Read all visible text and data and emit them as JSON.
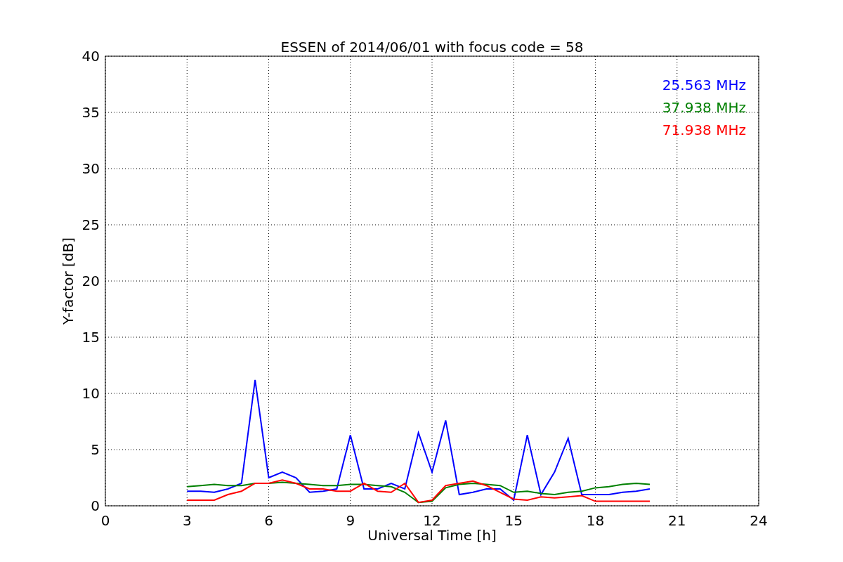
{
  "chart_data": {
    "type": "line",
    "title": "ESSEN of 2014/06/01 with focus code = 58",
    "xlabel": "Universal Time [h]",
    "ylabel": "Y-factor [dB]",
    "x": [
      3,
      3.5,
      4,
      4.5,
      5,
      5.5,
      6,
      6.5,
      7,
      7.5,
      8,
      8.5,
      9,
      9.5,
      10,
      10.5,
      11,
      11.5,
      12,
      12.5,
      13,
      13.5,
      14,
      14.5,
      15,
      15.5,
      16,
      16.5,
      17,
      17.5,
      18,
      18.5,
      19,
      19.5,
      20
    ],
    "series": [
      {
        "name": "25.563 MHz",
        "color": "#0000ff",
        "values": [
          1.3,
          1.3,
          1.2,
          1.5,
          2.0,
          11.2,
          2.5,
          3.0,
          2.5,
          1.2,
          1.3,
          1.5,
          6.3,
          1.5,
          1.5,
          2.0,
          1.5,
          6.5,
          3.0,
          7.6,
          1.0,
          1.2,
          1.5,
          1.5,
          0.5,
          6.3,
          1.0,
          3.0,
          6.0,
          1.0,
          1.0,
          1.0,
          1.2,
          1.3,
          1.5
        ]
      },
      {
        "name": "37.938 MHz",
        "color": "#008000",
        "values": [
          1.7,
          1.8,
          1.9,
          1.8,
          1.8,
          2.0,
          2.0,
          2.1,
          2.0,
          1.9,
          1.8,
          1.8,
          1.9,
          1.9,
          1.8,
          1.7,
          1.2,
          0.3,
          0.4,
          1.6,
          1.9,
          2.0,
          1.9,
          1.8,
          1.2,
          1.3,
          1.1,
          1.0,
          1.2,
          1.3,
          1.6,
          1.7,
          1.9,
          2.0,
          1.9
        ]
      },
      {
        "name": "71.938 MHz",
        "color": "#ff0000",
        "values": [
          0.5,
          0.5,
          0.5,
          1.0,
          1.3,
          2.0,
          2.0,
          2.3,
          2.0,
          1.5,
          1.5,
          1.3,
          1.3,
          2.0,
          1.3,
          1.2,
          2.0,
          0.3,
          0.5,
          1.8,
          2.0,
          2.2,
          1.8,
          1.2,
          0.6,
          0.5,
          0.8,
          0.7,
          0.8,
          0.9,
          0.4,
          0.4,
          0.4,
          0.4,
          0.4
        ]
      }
    ],
    "xlim": [
      0,
      24
    ],
    "ylim": [
      0,
      40
    ],
    "xticks": [
      0,
      3,
      6,
      9,
      12,
      15,
      18,
      21,
      24
    ],
    "yticks": [
      0,
      5,
      10,
      15,
      20,
      25,
      30,
      35,
      40
    ],
    "grid": true
  }
}
